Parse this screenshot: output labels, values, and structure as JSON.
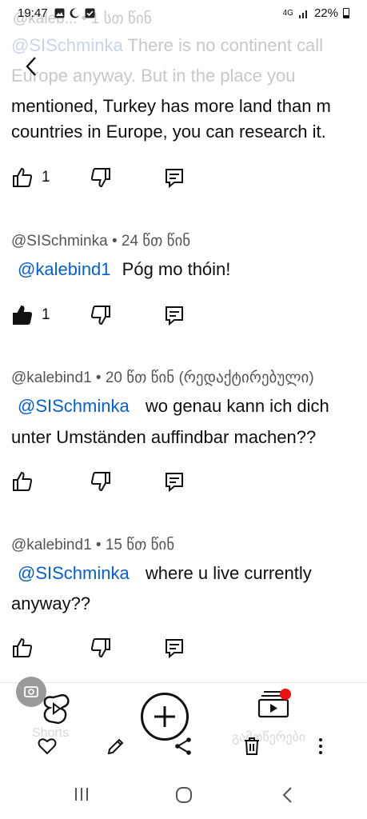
{
  "status_bar": {
    "time": "19:47",
    "network": "4G",
    "battery": "22%"
  },
  "ghost_top": {
    "meta": "@kaleb... • 1 სთ წინ",
    "mention": "@SISchminka",
    "line1_rest": "There is no continent call",
    "line2": "Europe anyway. But in the place you"
  },
  "comments": [
    {
      "text_lines": [
        "mentioned, Turkey has more land than m",
        "countries in Europe, you can research it."
      ],
      "likes": "1",
      "liked": false
    },
    {
      "meta": "@SISchminka • 24 წთ წინ",
      "mention": "@kalebind1",
      "text": "Póg mo thóin!",
      "likes": "1",
      "liked": true
    },
    {
      "meta": "@kalebind1 • 20 წთ წინ (რედაქტირებული)",
      "mention": "@SISchminka",
      "text": "wo genau kann ich dich",
      "text_line2": "unter Umständen auffindbar machen??",
      "likes": "",
      "liked": false
    },
    {
      "meta": "@kalebind1 • 15 წთ წინ",
      "mention": "@SISchminka",
      "text": "where u live currently",
      "text_line2": "anyway??",
      "likes": "",
      "liked": false
    }
  ],
  "bottom_nav": {
    "shorts_label": "Shorts",
    "subscriptions_label": "გამოწერები"
  },
  "icons": {
    "back": "chevron-left-icon",
    "like": "thumbs-up-icon",
    "dislike": "thumbs-down-icon",
    "reply": "reply-icon",
    "favorite": "heart-icon",
    "edit": "pencil-icon",
    "share": "share-icon",
    "delete": "trash-icon",
    "more": "more-vertical-icon"
  },
  "colors": {
    "mention": "#065fd4",
    "notification_dot": "#e11111"
  }
}
